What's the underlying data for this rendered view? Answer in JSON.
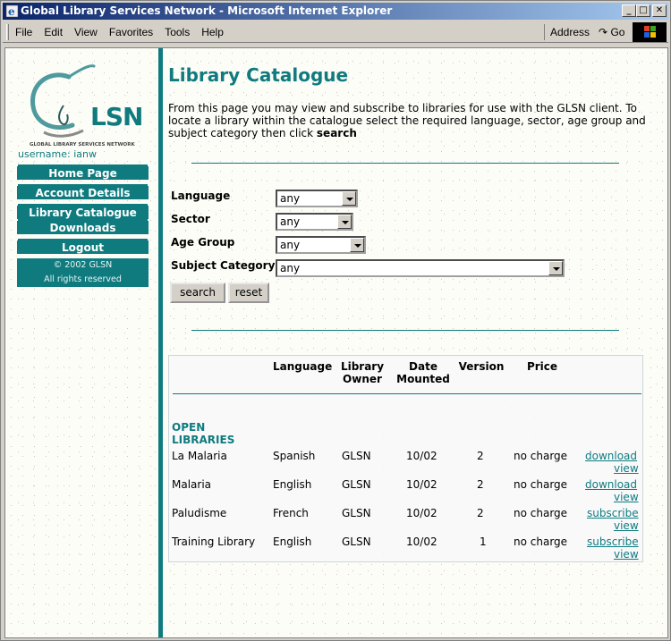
{
  "window": {
    "title": "Global Library Services Network - Microsoft Internet Explorer",
    "menu": [
      "File",
      "Edit",
      "View",
      "Favorites",
      "Tools",
      "Help"
    ],
    "address_label": "Address",
    "go_label": "Go"
  },
  "sidebar": {
    "logo_text": "LSN",
    "logo_subtitle": "GLOBAL LIBRARY SERVICES NETWORK",
    "username": "username: ianw",
    "nav": [
      "Home Page",
      "Account Details",
      "Library Catalogue",
      "Downloads",
      "Logout"
    ],
    "copyright_line1": "© 2002 GLSN",
    "copyright_line2": "All rights reserved"
  },
  "page": {
    "title": "Library Catalogue",
    "intro_text": "From this page you may view and subscribe to libraries for use with the GLSN client. To locate a library within the catalogue select the required language, sector, age group and subject category then click ",
    "intro_bold": "search"
  },
  "filters": {
    "language_label": "Language",
    "language_value": "any",
    "sector_label": "Sector",
    "sector_value": "any",
    "age_group_label": "Age Group",
    "age_group_value": "any",
    "subject_label": "Subject Category",
    "subject_value": "any",
    "search_button": "search",
    "reset_button": "reset"
  },
  "table": {
    "headers": {
      "language": "Language",
      "owner_line1": "Library",
      "owner_line2": "Owner",
      "mounted_line1": "Date",
      "mounted_line2": "Mounted",
      "version": "Version",
      "price": "Price"
    },
    "section_line1": "OPEN",
    "section_line2": "LIBRARIES",
    "rows": [
      {
        "name": "La Malaria",
        "language": "Spanish",
        "owner": "GLSN",
        "mounted": "10/02",
        "version": "2",
        "price": "no charge",
        "action": "download",
        "view": "view"
      },
      {
        "name": "Malaria",
        "language": "English",
        "owner": "GLSN",
        "mounted": "10/02",
        "version": "2",
        "price": "no charge",
        "action": "download",
        "view": "view"
      },
      {
        "name": "Paludisme",
        "language": "French",
        "owner": "GLSN",
        "mounted": "10/02",
        "version": "2",
        "price": "no charge",
        "action": "subscribe",
        "view": "view"
      },
      {
        "name": "Training Library",
        "language": "English",
        "owner": "GLSN",
        "mounted": "10/02",
        "version": "1",
        "price": "no charge",
        "action": "subscribe",
        "view": "view"
      }
    ]
  },
  "colors": {
    "accent": "#0f7b7f",
    "titlebar": "#0a246a"
  }
}
